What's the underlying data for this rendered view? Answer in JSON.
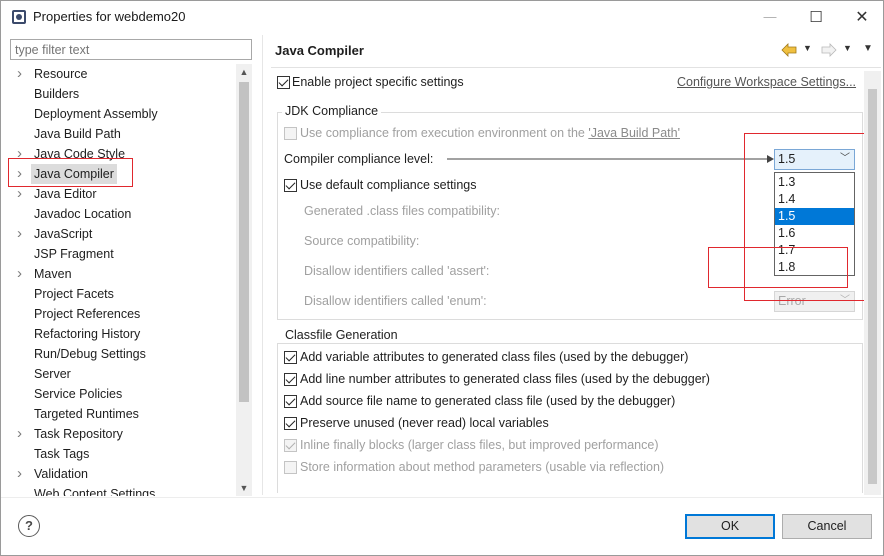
{
  "window": {
    "title": "Properties for webdemo20",
    "minimize_glyph": "—",
    "maximize_glyph": "☐",
    "close_glyph": "✕"
  },
  "sidebar": {
    "filter_placeholder": "type filter text",
    "items": [
      {
        "label": "Resource",
        "expandable": true
      },
      {
        "label": "Builders",
        "expandable": false
      },
      {
        "label": "Deployment Assembly",
        "expandable": false
      },
      {
        "label": "Java Build Path",
        "expandable": false
      },
      {
        "label": "Java Code Style",
        "expandable": true
      },
      {
        "label": "Java Compiler",
        "expandable": true,
        "selected": true
      },
      {
        "label": "Java Editor",
        "expandable": true
      },
      {
        "label": "Javadoc Location",
        "expandable": false
      },
      {
        "label": "JavaScript",
        "expandable": true
      },
      {
        "label": "JSP Fragment",
        "expandable": false
      },
      {
        "label": "Maven",
        "expandable": true
      },
      {
        "label": "Project Facets",
        "expandable": false
      },
      {
        "label": "Project References",
        "expandable": false
      },
      {
        "label": "Refactoring History",
        "expandable": false
      },
      {
        "label": "Run/Debug Settings",
        "expandable": false
      },
      {
        "label": "Server",
        "expandable": false
      },
      {
        "label": "Service Policies",
        "expandable": false
      },
      {
        "label": "Targeted Runtimes",
        "expandable": false
      },
      {
        "label": "Task Repository",
        "expandable": true
      },
      {
        "label": "Task Tags",
        "expandable": false
      },
      {
        "label": "Validation",
        "expandable": true
      },
      {
        "label": "Web Content Settings",
        "expandable": false
      }
    ]
  },
  "page": {
    "title": "Java Compiler",
    "enable_specific": "Enable project specific settings",
    "configure_workspace": "Configure Workspace Settings..."
  },
  "jdk": {
    "group_title": "JDK Compliance",
    "use_compliance_prefix": "Use compliance from execution environment on the ",
    "use_compliance_link": "'Java Build Path'",
    "compliance_level_label": "Compiler compliance level:",
    "compliance_value": "1.5",
    "compliance_options": [
      "1.3",
      "1.4",
      "1.5",
      "1.6",
      "1.7",
      "1.8"
    ],
    "selected_option": "1.5",
    "use_default": "Use default compliance settings",
    "generated_class": "Generated .class files compatibility:",
    "source_compat": "Source compatibility:",
    "disallow_assert": "Disallow identifiers called 'assert':",
    "disallow_enum": "Disallow identifiers called 'enum':",
    "enum_value": "Error"
  },
  "classfile": {
    "group_title": "Classfile Generation",
    "options": [
      {
        "label": "Add variable attributes to generated class files (used by the debugger)",
        "checked": true,
        "enabled": true
      },
      {
        "label": "Add line number attributes to generated class files (used by the debugger)",
        "checked": true,
        "enabled": true
      },
      {
        "label": "Add source file name to generated class file (used by the debugger)",
        "checked": true,
        "enabled": true
      },
      {
        "label": "Preserve unused (never read) local variables",
        "checked": true,
        "enabled": true
      },
      {
        "label": "Inline finally blocks (larger class files, but improved performance)",
        "checked": true,
        "enabled": false
      },
      {
        "label": "Store information about method parameters (usable via reflection)",
        "checked": false,
        "enabled": false
      }
    ]
  },
  "footer": {
    "help_glyph": "?",
    "ok_label": "OK",
    "cancel_label": "Cancel"
  },
  "colors": {
    "selection_blue": "#0078d7",
    "annotation_red": "#e0282e",
    "combo_bg": "#e5f1fb"
  }
}
